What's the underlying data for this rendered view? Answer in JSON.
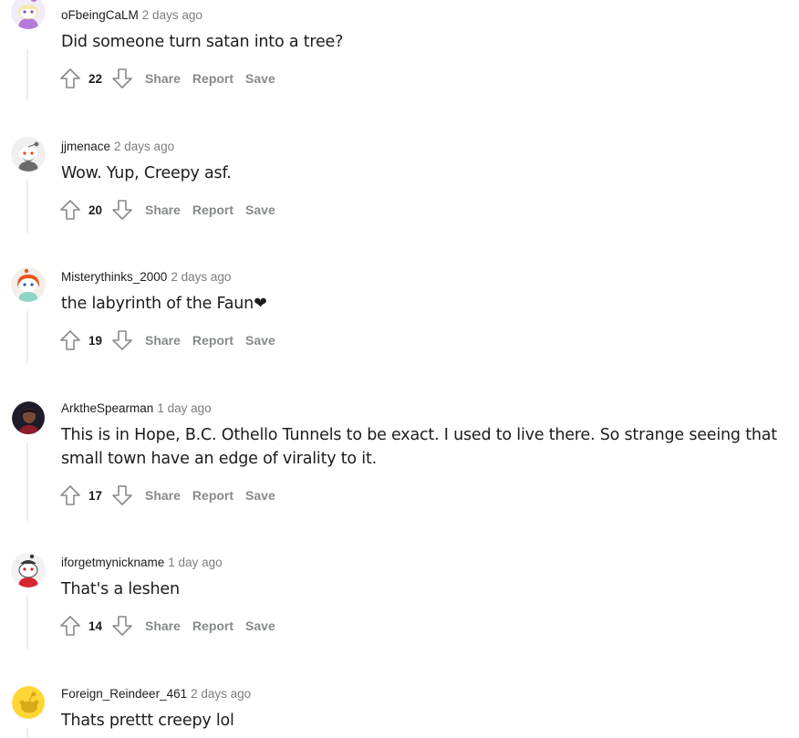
{
  "comments": [
    {
      "username": "oFbeingCaLM",
      "time": "2 days ago",
      "text": "Did someone turn satan into a tree?",
      "score": "22",
      "avatar": "avatar-purple-snoo",
      "actions": {
        "share": "Share",
        "report": "Report",
        "save": "Save"
      }
    },
    {
      "username": "jjmenace",
      "time": "2 days ago",
      "text": "Wow. Yup, Creepy asf.",
      "score": "20",
      "avatar": "avatar-bearded-snoo",
      "actions": {
        "share": "Share",
        "report": "Report",
        "save": "Save"
      }
    },
    {
      "username": "Misterythinks_2000",
      "time": "2 days ago",
      "text": "the labyrinth of the Faun❤",
      "score": "19",
      "avatar": "avatar-redhair-snoo",
      "actions": {
        "share": "Share",
        "report": "Report",
        "save": "Save"
      }
    },
    {
      "username": "ArktheSpearman",
      "time": "1 day ago",
      "text": "This is in Hope, B.C. Othello Tunnels to be exact. I used to live there. So strange seeing that small town have an edge of virality to it.",
      "score": "17",
      "avatar": "avatar-photo",
      "actions": {
        "share": "Share",
        "report": "Report",
        "save": "Save"
      }
    },
    {
      "username": "iforgetmynickname",
      "time": "1 day ago",
      "text": "That's a leshen",
      "score": "14",
      "avatar": "avatar-red-shirt-snoo",
      "actions": {
        "share": "Share",
        "report": "Report",
        "save": "Save"
      }
    },
    {
      "username": "Foreign_Reindeer_461",
      "time": "2 days ago",
      "text": "Thats prettt creepy lol",
      "avatar": "avatar-yellow-default-snoo"
    }
  ],
  "colors": {
    "text": "#1c1c1c",
    "meta": "#7c7c7c",
    "action": "#878a8c",
    "thread_line": "#edeff1"
  },
  "icons": {
    "upvote": "upvote-arrow-icon",
    "downvote": "downvote-arrow-icon"
  }
}
